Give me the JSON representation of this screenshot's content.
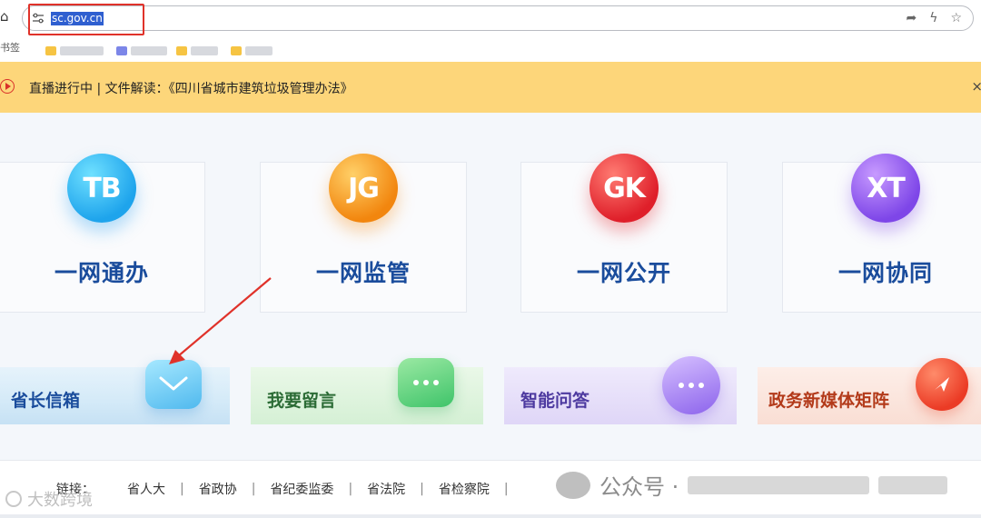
{
  "browser": {
    "url": "sc.gov.cn",
    "bookmarks_label": "书签"
  },
  "notice": {
    "text": "直播进行中 | 文件解读：《四川省城市建筑垃圾管理办法》",
    "close": "×"
  },
  "services": [
    {
      "badge": "TB",
      "title": "一网通办"
    },
    {
      "badge": "JG",
      "title": "一网监管"
    },
    {
      "badge": "GK",
      "title": "一网公开"
    },
    {
      "badge": "XT",
      "title": "一网协同"
    }
  ],
  "quick_tiles": [
    {
      "label": "省长信箱",
      "icon": "envelope-icon"
    },
    {
      "label": "我要留言",
      "icon": "chat-bubble-icon"
    },
    {
      "label": "智能问答",
      "icon": "ai-chat-icon"
    },
    {
      "label": "政务新媒体矩阵",
      "icon": "paper-plane-icon"
    }
  ],
  "footer": {
    "links_label": "链接：",
    "links": [
      "省人大",
      "省政协",
      "省纪委监委",
      "省法院",
      "省检察院"
    ],
    "watermark_text": "公众号 ·",
    "watermark2_text": "大数跨境"
  },
  "colors": {
    "notice_bg": "#fdd67a",
    "title_blue": "#1a4c9c",
    "annotation_red": "#e0322a"
  }
}
